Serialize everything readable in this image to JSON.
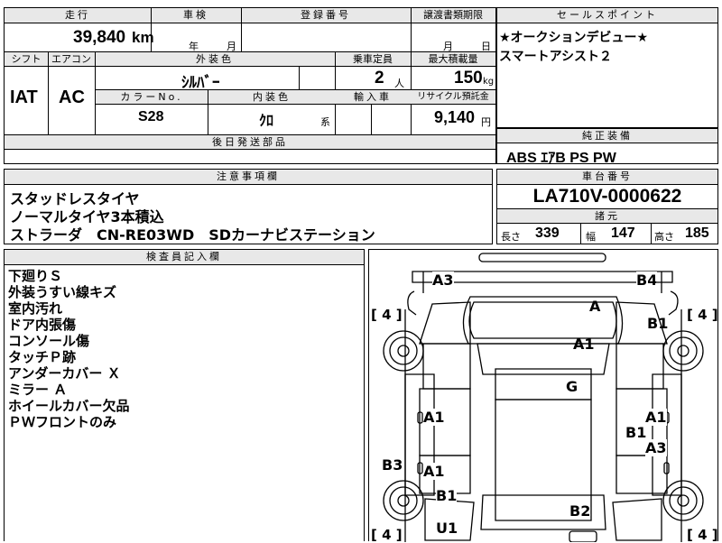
{
  "top_left": {
    "headers": {
      "mileage": "走行",
      "inspection": "車検",
      "registration": "登録番号"
    },
    "mileage_value": "39,840",
    "mileage_unit": "km",
    "inspection_year_unit": "年",
    "inspection_month_unit": "月",
    "headers2": {
      "shift": "シフト",
      "aircon": "エアコン",
      "exterior_color": "外装色",
      "capacity": "乗車定員",
      "max_load": "最大積載量"
    },
    "shift_value": "IAT",
    "aircon_value": "AC",
    "exterior_color_value": "ｼﾙﾊﾞｰ",
    "capacity_value": "2",
    "capacity_unit": "人",
    "max_load_value": "150",
    "max_load_unit": "kg",
    "headers3": {
      "color_no": "カラーNo.",
      "interior_color": "内装色",
      "import": "輸入車",
      "recycle": "リサイクル預託金"
    },
    "color_no_value": "S28",
    "interior_color_value": "ｸﾛ",
    "interior_color_suffix": "系",
    "recycle_value": "9,140",
    "recycle_unit": "円",
    "later_parts_header": "後日発送部品"
  },
  "transfer": {
    "header": "譲渡書類期限",
    "month_unit": "月",
    "day_unit": "日"
  },
  "sales_points": {
    "header": "セールスポイント",
    "lines": [
      "★オークションデビュー★",
      "スマートアシスト２"
    ]
  },
  "genuine_equipment": {
    "header": "純正装備",
    "value": "ABS ｴｱB PS PW"
  },
  "notes": {
    "header": "注意事項欄",
    "lines": [
      "スタッドレスタイヤ",
      "ノーマルタイヤ3本積込",
      "ストラーダ　CN-RE03WD　SDカーナビステーション"
    ]
  },
  "chassis": {
    "header": "車台番号",
    "value": "LA710V-0000622",
    "specs_header": "諸元",
    "length_label": "長さ",
    "length_value": "339",
    "width_label": "幅",
    "width_value": "147",
    "height_label": "高さ",
    "height_value": "185"
  },
  "inspector": {
    "header": "検査員記入欄",
    "lines": [
      "下廻りＳ",
      "外装うすい線キズ",
      "室内汚れ",
      "ドア内張傷",
      "コンソール傷",
      "タッチＰ跡",
      "アンダーカバー Ｘ",
      "ミラー Ａ",
      "ホイールカバー欠品",
      "ＰＷフロントのみ"
    ]
  },
  "diagram": {
    "tire_marks": [
      "[ 4 ]",
      "[ 4 ]",
      "[ 4 ]",
      "[ 4 ]"
    ],
    "labels": [
      "A3",
      "B4",
      "A",
      "B1",
      "A1",
      "G",
      "A1",
      "A1",
      "B1",
      "A3",
      "B3",
      "A1",
      "B1",
      "B2",
      "U1"
    ]
  }
}
